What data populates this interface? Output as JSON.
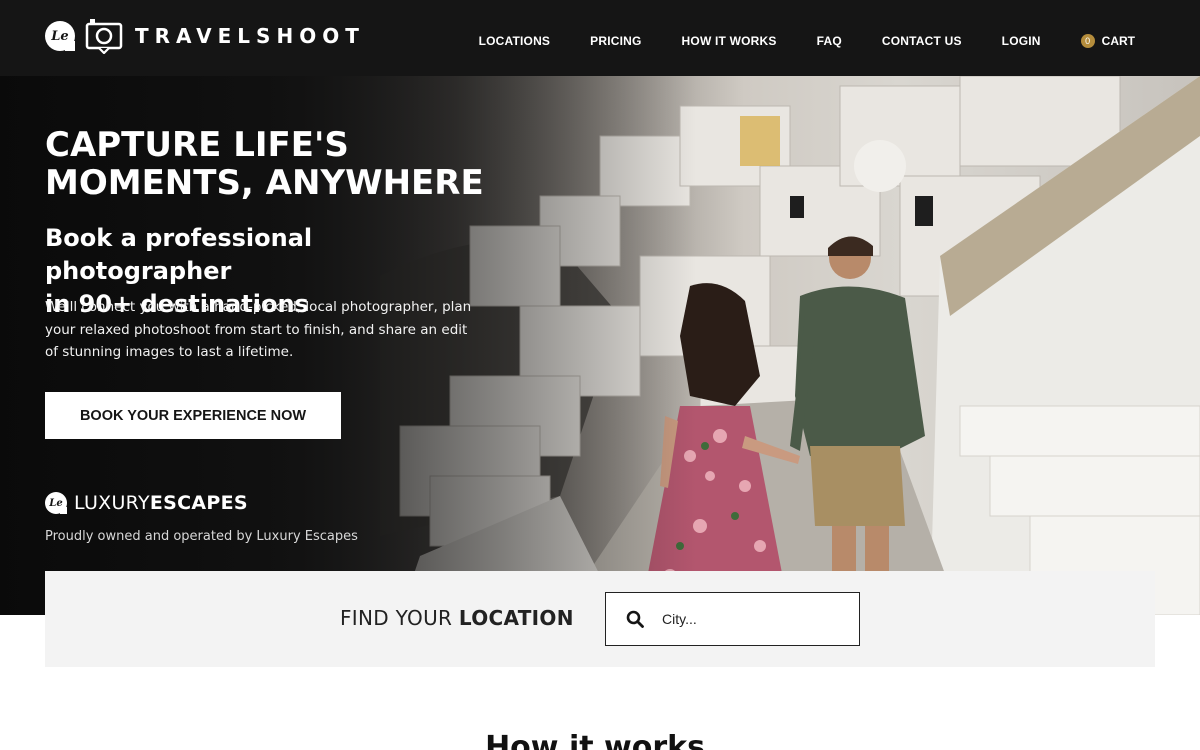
{
  "header": {
    "logo_badge": "Le",
    "brand": "TRAVELSHOOT",
    "nav": [
      "LOCATIONS",
      "PRICING",
      "HOW IT WORKS",
      "FAQ",
      "CONTACT US",
      "LOGIN"
    ],
    "cart_count": "0",
    "cart_label": "CART",
    "background": "#151515",
    "cart_badge_color": "#b58d3c"
  },
  "hero": {
    "title_line1": "CAPTURE LIFE'S",
    "title_line2": "MOMENTS, ANYWHERE",
    "subtitle_line1": "Book a professional photographer",
    "subtitle_line2": "in 90+ destinations",
    "para_line1": "We'll connect you with a hand-picked, local photographer, plan",
    "para_line2": "your relaxed photoshoot from start to finish, and share an edit",
    "para_line3": "of stunning images to last a lifetime.",
    "cta": "BOOK YOUR EXPERIENCE NOW",
    "partner_badge": "Le",
    "partner_light": "LUXURY",
    "partner_bold": "ESCAPES",
    "owned_text": "Proudly owned and operated by Luxury Escapes",
    "image_description_icon": "couple-walking-santorini-photo"
  },
  "finder": {
    "label_light": "FIND YOUR ",
    "label_bold": "LOCATION",
    "placeholder": "City...",
    "icon": "search-icon"
  },
  "section": {
    "how_title": "How it works"
  }
}
